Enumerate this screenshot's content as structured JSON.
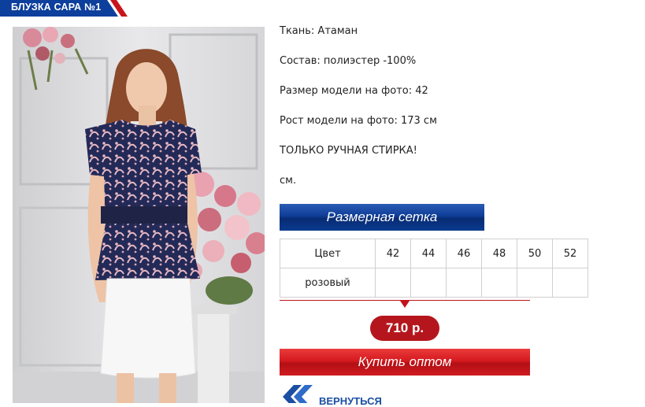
{
  "product": {
    "title": "БЛУЗКА САРА №1"
  },
  "specs": [
    "Ткань: Атаман",
    "Состав: полиэстер -100%",
    "Размер модели на фото: 42",
    "Рост модели на фото: 173 см",
    "ТОЛЬКО РУЧНАЯ СТИРКА!",
    "см."
  ],
  "size_chart_button": "Размерная сетка",
  "size_table": {
    "header_label": "Цвет",
    "sizes": [
      "42",
      "44",
      "46",
      "48",
      "50",
      "52"
    ],
    "rows": [
      {
        "color": "розовый",
        "cells": [
          "",
          "",
          "",
          "",
          "",
          ""
        ]
      }
    ]
  },
  "price": "710 р.",
  "buy_button": "Купить оптом",
  "back_link": "ВЕРНУТЬСЯ",
  "colors": {
    "brand_blue": "#0e3d96",
    "accent_red": "#c0141a",
    "link_blue": "#1a4fa3"
  }
}
